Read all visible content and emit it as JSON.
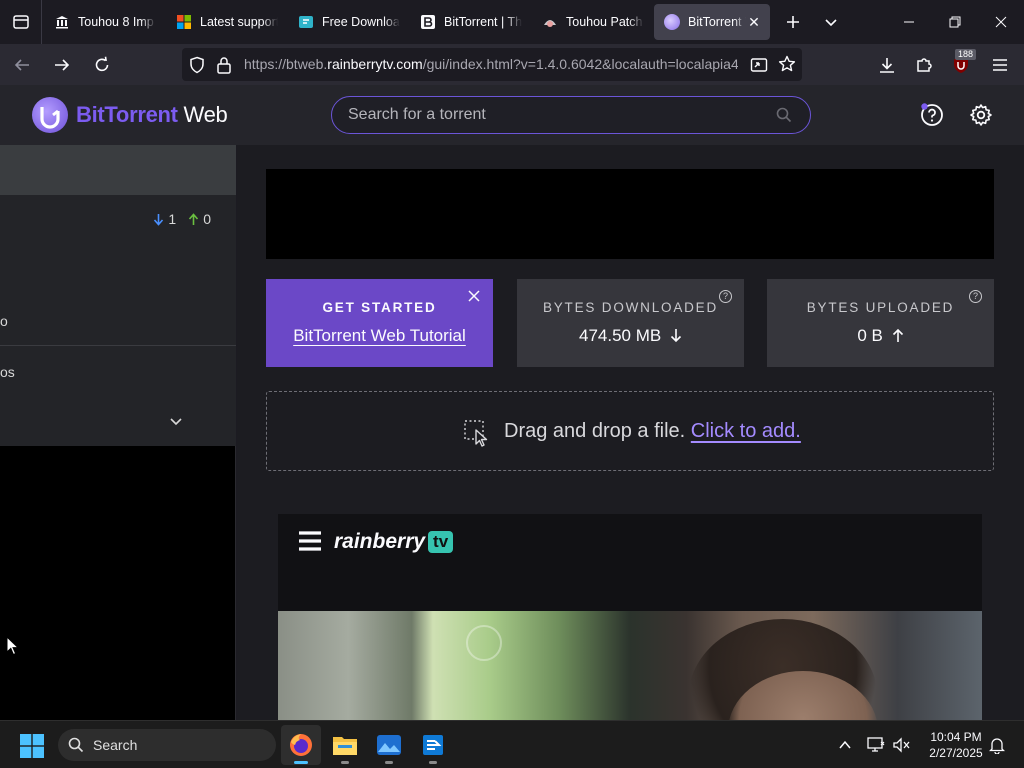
{
  "browser": {
    "tabs": [
      {
        "title": "Touhou 8 Imp",
        "icon": "museum-icon",
        "active": false
      },
      {
        "title": "Latest support",
        "icon": "microsoft-icon",
        "active": false
      },
      {
        "title": "Free Downloa",
        "icon": "download-site-icon",
        "active": false
      },
      {
        "title": "BitTorrent | The",
        "icon": "bittorrent-b-icon",
        "active": false
      },
      {
        "title": "Touhou Patch",
        "icon": "touhou-patch-icon",
        "active": false
      },
      {
        "title": "BitTorrent W",
        "icon": "bittorrent-web-icon",
        "active": true
      }
    ],
    "url": {
      "prefix": "https://btweb.",
      "host": "rainberrytv.com",
      "suffix": "/gui/index.html?v=1.4.0.6042&localauth=localapia4"
    },
    "extension_badge": "188"
  },
  "app": {
    "logo_brand": "BitTorrent",
    "logo_suffix": " Web",
    "search_placeholder": "Search for a torrent"
  },
  "sidebar": {
    "download_count": "1",
    "upload_count": "0",
    "item_1_label": "o",
    "item_2_label": "os"
  },
  "cards": {
    "get_started_title": "GET STARTED",
    "get_started_link": "BitTorrent Web Tutorial",
    "downloaded_title": "BYTES DOWNLOADED",
    "downloaded_value": "474.50 MB",
    "uploaded_title": "BYTES UPLOADED",
    "uploaded_value": "0 B"
  },
  "dropzone": {
    "text": "Drag and drop a file.",
    "link": "Click to add."
  },
  "ad": {
    "brand": "rainberry",
    "brand_tv": "tv"
  },
  "taskbar": {
    "search_label": "Search",
    "time": "10:04 PM",
    "date": "2/27/2025"
  },
  "colors": {
    "accent": "#6b48c7",
    "link": "#a48bff",
    "download_arrow": "#4a90ff",
    "upload_arrow": "#6abf40",
    "taskbar_active": "#4cc2ff"
  }
}
